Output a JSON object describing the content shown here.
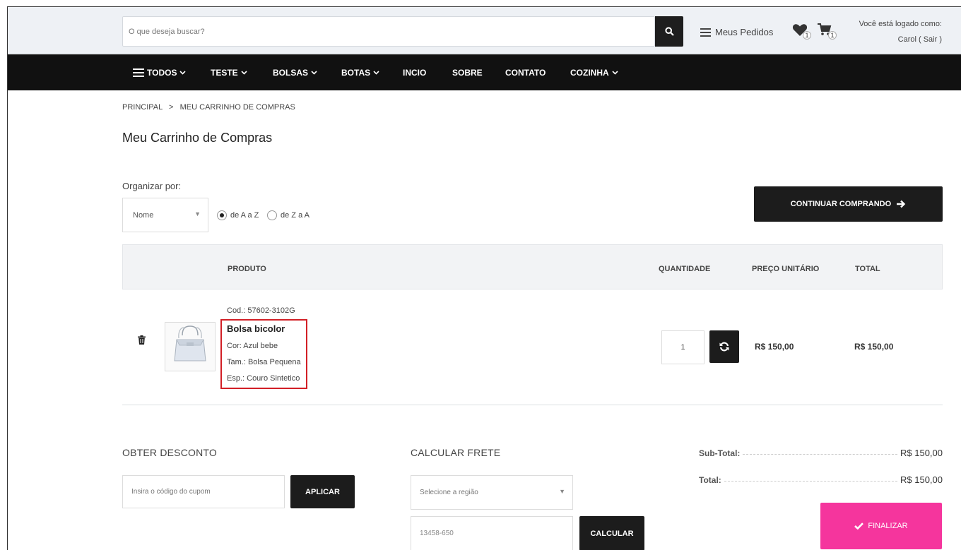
{
  "header": {
    "search_placeholder": "O que deseja buscar?",
    "orders_label": "Meus Pedidos",
    "wishlist_count": "1",
    "cart_count": "1",
    "login_line1": "Você está logado como:",
    "login_line2": "Carol ( Sair )"
  },
  "nav": {
    "items": [
      "TODOS",
      "TESTE",
      "BOLSAS",
      "BOTAS",
      "INCIO",
      "SOBRE",
      "CONTATO",
      "COZINHA"
    ]
  },
  "breadcrumb": {
    "home": "PRINCIPAL",
    "sep": ">",
    "current": "MEU CARRINHO DE COMPRAS"
  },
  "page": {
    "title": "Meu Carrinho de Compras"
  },
  "sort": {
    "label": "Organizar por:",
    "selected": "Nome",
    "options": [
      "de A a Z",
      "de Z a A"
    ],
    "checked_index": 0
  },
  "continue_button": "CONTINUAR COMPRANDO",
  "table": {
    "headers": {
      "product": "PRODUTO",
      "quantity": "QUANTIDADE",
      "unit_price": "PREÇO UNITÁRIO",
      "total": "TOTAL"
    },
    "rows": [
      {
        "code": "Cod.: 57602-3102G",
        "name": "Bolsa bicolor",
        "color": "Cor: Azul bebe",
        "size": "Tam.: Bolsa Pequena",
        "spec": "Esp.: Couro Sintetico",
        "quantity": "1",
        "unit_price": "R$ 150,00",
        "total": "R$ 150,00"
      }
    ]
  },
  "discount": {
    "title": "OBTER DESCONTO",
    "placeholder": "Insira o código do cupom",
    "button": "APLICAR"
  },
  "shipping": {
    "title": "CALCULAR FRETE",
    "region_placeholder": "Selecione a região",
    "zip_value": "13458-650",
    "button": "CALCULAR"
  },
  "summary": {
    "subtotal_label": "Sub-Total:",
    "subtotal_value": "R$ 150,00",
    "total_label": "Total:",
    "total_value": "R$ 150,00",
    "finish_button": "FINALIZAR"
  },
  "colors": {
    "finish": "#f5359d",
    "dark": "#1c1c1c",
    "highlight": "#d21f26"
  }
}
